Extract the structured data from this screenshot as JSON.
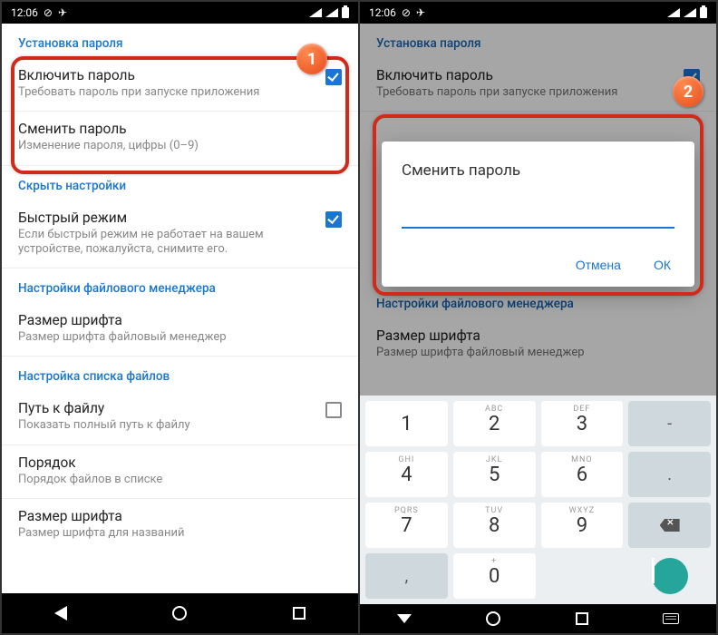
{
  "status": {
    "time": "12:06"
  },
  "badges": {
    "one": "1",
    "two": "2"
  },
  "sections": {
    "password": {
      "header": "Установка пароля",
      "enable": {
        "title": "Включить пароль",
        "sub": "Требовать пароль при запуске приложения"
      },
      "change": {
        "title": "Сменить пароль",
        "sub": "Изменение пароля, цифры (0–9)"
      }
    },
    "hide": {
      "header": "Скрыть настройки",
      "fast": {
        "title": "Быстрый режим",
        "sub": "Если быстрый режим не работает на вашем устройстве, пожалуйста, снимите его."
      }
    },
    "fm": {
      "header": "Настройки файлового менеджера",
      "font": {
        "title": "Размер шрифта",
        "sub": "Размер шрифта файловый менеджер"
      }
    },
    "list": {
      "header": "Настройка списка файлов",
      "path": {
        "title": "Путь к файлу",
        "sub": "Показать полный путь к файлу"
      },
      "order": {
        "title": "Порядок",
        "sub": "Порядок файлов в списке"
      },
      "font2": {
        "title": "Размер шрифта",
        "sub": "Размер шрифта для названий"
      }
    }
  },
  "dialog": {
    "title": "Сменить пароль",
    "cancel": "Отмена",
    "ok": "ОК"
  },
  "keypad": {
    "k1": "1",
    "k2": "2",
    "k3": "3",
    "dash": "-",
    "k4": "4",
    "k5": "5",
    "k6": "6",
    "dot": ".",
    "k7": "7",
    "k8": "8",
    "k9": "9",
    "comma": ",",
    "k0": "0",
    "sub2": "ABC",
    "sub3": "DEF",
    "sub4": "GHI",
    "sub5": "JKL",
    "sub6": "MNO",
    "sub7": "PQRS",
    "sub8": "TUV",
    "sub9": "WXYZ",
    "sub0": "+"
  }
}
